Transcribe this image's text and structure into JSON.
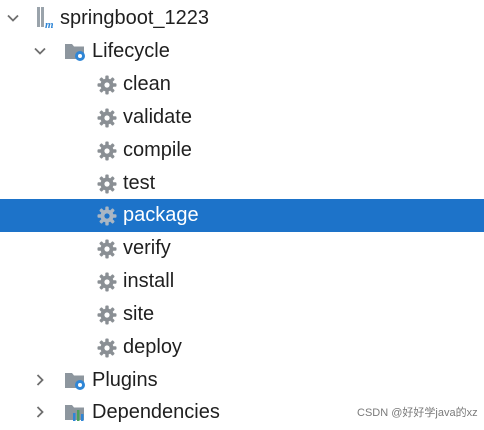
{
  "tree": {
    "root": {
      "label": "springboot_1223",
      "icon": "maven-module-icon",
      "expanded": true
    },
    "lifecycle": {
      "label": "Lifecycle",
      "icon": "folder-gear-icon",
      "expanded": true,
      "goals": [
        {
          "label": "clean",
          "icon": "gear-icon",
          "selected": false
        },
        {
          "label": "validate",
          "icon": "gear-icon",
          "selected": false
        },
        {
          "label": "compile",
          "icon": "gear-icon",
          "selected": false
        },
        {
          "label": "test",
          "icon": "gear-icon",
          "selected": false
        },
        {
          "label": "package",
          "icon": "gear-icon",
          "selected": true
        },
        {
          "label": "verify",
          "icon": "gear-icon",
          "selected": false
        },
        {
          "label": "install",
          "icon": "gear-icon",
          "selected": false
        },
        {
          "label": "site",
          "icon": "gear-icon",
          "selected": false
        },
        {
          "label": "deploy",
          "icon": "gear-icon",
          "selected": false
        }
      ]
    },
    "plugins": {
      "label": "Plugins",
      "icon": "folder-gear-icon",
      "expanded": false
    },
    "dependencies": {
      "label": "Dependencies",
      "icon": "dependencies-chart-icon",
      "expanded": false
    }
  },
  "watermark": "CSDN @好好学java的xz",
  "colors": {
    "selection": "#1d73c9",
    "chevron": "#6e6e6e",
    "gear": "#8a8f94",
    "folder": "#8d969e",
    "accent_blue": "#2f86d6"
  }
}
